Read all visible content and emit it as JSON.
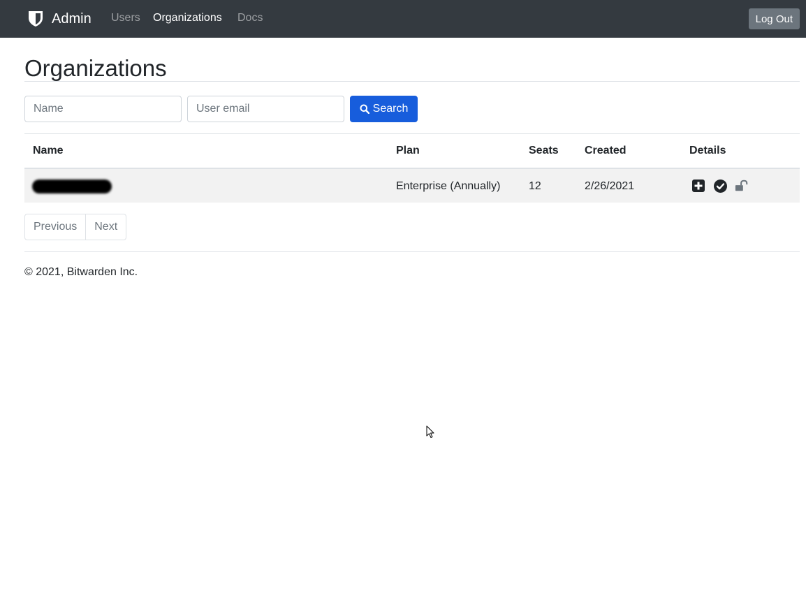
{
  "navbar": {
    "brand_label": "Admin",
    "brand_icon": "bitwarden-shield-icon",
    "links": [
      {
        "label": "Users",
        "active": false
      },
      {
        "label": "Organizations",
        "active": true
      },
      {
        "label": "Docs",
        "active": false
      }
    ],
    "logout_label": "Log Out",
    "background_color": "#343a40"
  },
  "page": {
    "title": "Organizations"
  },
  "filters": {
    "name_placeholder": "Name",
    "name_value": "",
    "email_placeholder": "User email",
    "email_value": "",
    "search_label": "Search",
    "search_icon": "search-icon",
    "accent_color": "#175ddc"
  },
  "table": {
    "columns": [
      "Name",
      "Plan",
      "Seats",
      "Created",
      "Details"
    ],
    "rows": [
      {
        "name": "",
        "name_redacted": true,
        "plan": "Enterprise (Annually)",
        "seats": "12",
        "created": "2/26/2021",
        "detail_icons": [
          "plus-square-icon",
          "check-circle-icon",
          "unlock-icon"
        ]
      }
    ]
  },
  "pagination": {
    "previous_label": "Previous",
    "next_label": "Next"
  },
  "footer": {
    "text": "© 2021, Bitwarden Inc."
  }
}
